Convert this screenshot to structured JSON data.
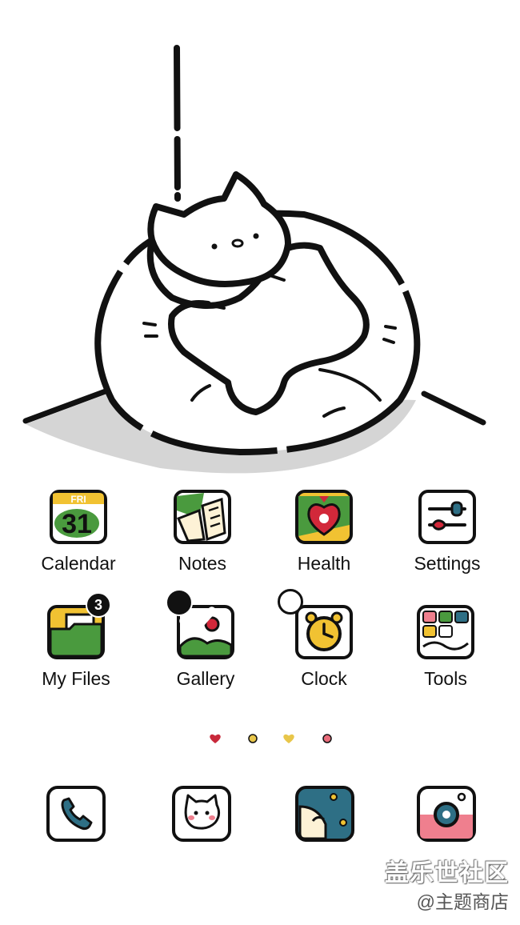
{
  "home_apps": [
    {
      "label": "Calendar",
      "icon": "calendar-icon",
      "day": "FRI",
      "date": "31"
    },
    {
      "label": "Notes",
      "icon": "notes-icon"
    },
    {
      "label": "Health",
      "icon": "health-icon"
    },
    {
      "label": "Settings",
      "icon": "settings-icon"
    },
    {
      "label": "My Files",
      "icon": "folder-icon",
      "badge": "3"
    },
    {
      "label": "Gallery",
      "icon": "gallery-icon",
      "selected": true
    },
    {
      "label": "Clock",
      "icon": "clock-icon",
      "selected": false
    },
    {
      "label": "Tools",
      "icon": "tools-folder-icon"
    }
  ],
  "page_indicator": {
    "pages": 4,
    "shapes": [
      "heart",
      "circle",
      "heart",
      "circle"
    ],
    "colors": [
      "#c8283a",
      "#e8c64a",
      "#e8c64a",
      "#e86b7a"
    ]
  },
  "dock": [
    {
      "icon": "phone-icon"
    },
    {
      "icon": "messages-cat-icon"
    },
    {
      "icon": "browser-icon"
    },
    {
      "icon": "camera-icon"
    }
  ],
  "watermark": {
    "main": "盖乐世社区",
    "sub": "@主题商店"
  },
  "colors": {
    "ink": "#111111",
    "green": "#4a9a3e",
    "yellow": "#f1c232",
    "red": "#d2283a",
    "teal": "#2e6f85",
    "pink": "#ef7f8e"
  }
}
